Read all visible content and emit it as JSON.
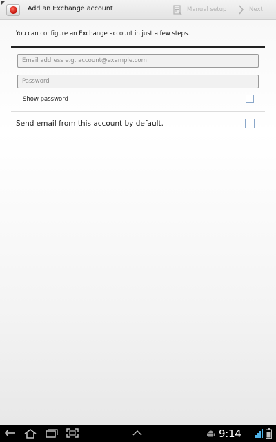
{
  "action_bar": {
    "app_icon": "exchange-app-icon",
    "title": "Add an Exchange account",
    "manual_setup_label": "Manual setup",
    "manual_setup_icon": "manual-setup-icon",
    "next_label": "Next",
    "next_icon": "chevron-right-icon",
    "disabled_color": "#b3b3b3"
  },
  "form": {
    "intro": "You can configure an Exchange account in just a few steps.",
    "email_placeholder": "Email address e.g. account@example.com",
    "email_value": "",
    "password_placeholder": "Password",
    "password_value": "",
    "show_password_label": "Show password",
    "show_password_checked": false,
    "default_label": "Send email from this account by default.",
    "default_checked": false
  },
  "nav_bar": {
    "buttons": [
      "back-icon",
      "home-icon",
      "recent-apps-icon",
      "screenshot-icon",
      "chevron-up-icon"
    ],
    "time": "9:14",
    "status_icons": [
      "android-debug-icon",
      "signal-icon",
      "battery-icon"
    ]
  },
  "colors": {
    "checkbox_border": "#8aa7c9",
    "nav_background": "#000000"
  }
}
